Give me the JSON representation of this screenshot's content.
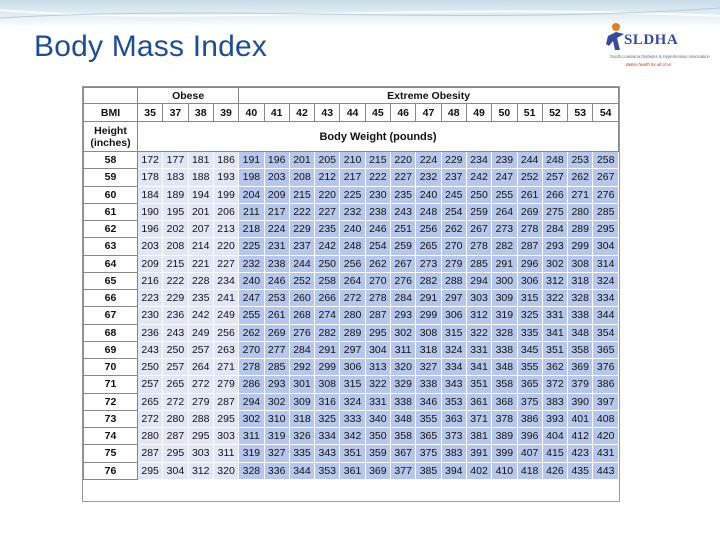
{
  "slide": {
    "title": "Body Mass Index",
    "logo": {
      "name": "SLDHA",
      "tagline": "South Louisiana Diabetes & Hypertension Association",
      "subtitle": "Better health for all of us"
    }
  },
  "colors": {
    "title": "#1f4e8c",
    "obese_cell": "#e1e7f6",
    "extreme_cell": "#b7c7eb"
  },
  "table": {
    "group_headers": {
      "obese": "Obese",
      "extreme": "Extreme Obesity"
    },
    "bmi_label": "BMI",
    "height_label": "Height (inches)",
    "weight_label": "Body Weight (pounds)",
    "bmi_values": [
      "35",
      "37",
      "38",
      "39",
      "40",
      "41",
      "42",
      "43",
      "44",
      "45",
      "46",
      "47",
      "48",
      "49",
      "50",
      "51",
      "52",
      "53",
      "54"
    ],
    "rows": [
      {
        "h": "58",
        "w": [
          "172",
          "177",
          "181",
          "186",
          "191",
          "196",
          "201",
          "205",
          "210",
          "215",
          "220",
          "224",
          "229",
          "234",
          "239",
          "244",
          "248",
          "253",
          "258"
        ]
      },
      {
        "h": "59",
        "w": [
          "178",
          "183",
          "188",
          "193",
          "198",
          "203",
          "208",
          "212",
          "217",
          "222",
          "227",
          "232",
          "237",
          "242",
          "247",
          "252",
          "257",
          "262",
          "267"
        ]
      },
      {
        "h": "60",
        "w": [
          "184",
          "189",
          "194",
          "199",
          "204",
          "209",
          "215",
          "220",
          "225",
          "230",
          "235",
          "240",
          "245",
          "250",
          "255",
          "261",
          "266",
          "271",
          "276"
        ]
      },
      {
        "h": "61",
        "w": [
          "190",
          "195",
          "201",
          "206",
          "211",
          "217",
          "222",
          "227",
          "232",
          "238",
          "243",
          "248",
          "254",
          "259",
          "264",
          "269",
          "275",
          "280",
          "285"
        ]
      },
      {
        "h": "62",
        "w": [
          "196",
          "202",
          "207",
          "213",
          "218",
          "224",
          "229",
          "235",
          "240",
          "246",
          "251",
          "256",
          "262",
          "267",
          "273",
          "278",
          "284",
          "289",
          "295"
        ]
      },
      {
        "h": "63",
        "w": [
          "203",
          "208",
          "214",
          "220",
          "225",
          "231",
          "237",
          "242",
          "248",
          "254",
          "259",
          "265",
          "270",
          "278",
          "282",
          "287",
          "293",
          "299",
          "304"
        ]
      },
      {
        "h": "64",
        "w": [
          "209",
          "215",
          "221",
          "227",
          "232",
          "238",
          "244",
          "250",
          "256",
          "262",
          "267",
          "273",
          "279",
          "285",
          "291",
          "296",
          "302",
          "308",
          "314"
        ]
      },
      {
        "h": "65",
        "w": [
          "216",
          "222",
          "228",
          "234",
          "240",
          "246",
          "252",
          "258",
          "264",
          "270",
          "276",
          "282",
          "288",
          "294",
          "300",
          "306",
          "312",
          "318",
          "324"
        ]
      },
      {
        "h": "66",
        "w": [
          "223",
          "229",
          "235",
          "241",
          "247",
          "253",
          "260",
          "266",
          "272",
          "278",
          "284",
          "291",
          "297",
          "303",
          "309",
          "315",
          "322",
          "328",
          "334"
        ]
      },
      {
        "h": "67",
        "w": [
          "230",
          "236",
          "242",
          "249",
          "255",
          "261",
          "268",
          "274",
          "280",
          "287",
          "293",
          "299",
          "306",
          "312",
          "319",
          "325",
          "331",
          "338",
          "344"
        ]
      },
      {
        "h": "68",
        "w": [
          "236",
          "243",
          "249",
          "256",
          "262",
          "269",
          "276",
          "282",
          "289",
          "295",
          "302",
          "308",
          "315",
          "322",
          "328",
          "335",
          "341",
          "348",
          "354"
        ]
      },
      {
        "h": "69",
        "w": [
          "243",
          "250",
          "257",
          "263",
          "270",
          "277",
          "284",
          "291",
          "297",
          "304",
          "311",
          "318",
          "324",
          "331",
          "338",
          "345",
          "351",
          "358",
          "365"
        ]
      },
      {
        "h": "70",
        "w": [
          "250",
          "257",
          "264",
          "271",
          "278",
          "285",
          "292",
          "299",
          "306",
          "313",
          "320",
          "327",
          "334",
          "341",
          "348",
          "355",
          "362",
          "369",
          "376"
        ]
      },
      {
        "h": "71",
        "w": [
          "257",
          "265",
          "272",
          "279",
          "286",
          "293",
          "301",
          "308",
          "315",
          "322",
          "329",
          "338",
          "343",
          "351",
          "358",
          "365",
          "372",
          "379",
          "386"
        ]
      },
      {
        "h": "72",
        "w": [
          "265",
          "272",
          "279",
          "287",
          "294",
          "302",
          "309",
          "316",
          "324",
          "331",
          "338",
          "346",
          "353",
          "361",
          "368",
          "375",
          "383",
          "390",
          "397"
        ]
      },
      {
        "h": "73",
        "w": [
          "272",
          "280",
          "288",
          "295",
          "302",
          "310",
          "318",
          "325",
          "333",
          "340",
          "348",
          "355",
          "363",
          "371",
          "378",
          "386",
          "393",
          "401",
          "408"
        ]
      },
      {
        "h": "74",
        "w": [
          "280",
          "287",
          "295",
          "303",
          "311",
          "319",
          "326",
          "334",
          "342",
          "350",
          "358",
          "365",
          "373",
          "381",
          "389",
          "396",
          "404",
          "412",
          "420"
        ]
      },
      {
        "h": "75",
        "w": [
          "287",
          "295",
          "303",
          "311",
          "319",
          "327",
          "335",
          "343",
          "351",
          "359",
          "367",
          "375",
          "383",
          "391",
          "399",
          "407",
          "415",
          "423",
          "431"
        ]
      },
      {
        "h": "76",
        "w": [
          "295",
          "304",
          "312",
          "320",
          "328",
          "336",
          "344",
          "353",
          "361",
          "369",
          "377",
          "385",
          "394",
          "402",
          "410",
          "418",
          "426",
          "435",
          "443"
        ]
      }
    ]
  }
}
